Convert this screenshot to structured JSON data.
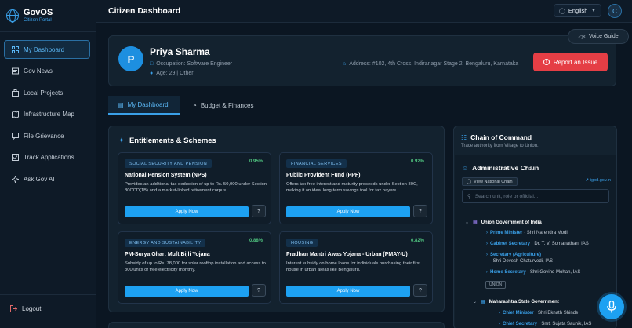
{
  "brand": {
    "name": "GovOS",
    "subtitle": "Citizen Portal"
  },
  "sidebar": {
    "items": [
      {
        "label": "My Dashboard",
        "icon": "dashboard-icon",
        "active": true
      },
      {
        "label": "Gov News",
        "icon": "news-icon"
      },
      {
        "label": "Local Projects",
        "icon": "briefcase-icon"
      },
      {
        "label": "Infrastructure Map",
        "icon": "map-icon"
      },
      {
        "label": "File Grievance",
        "icon": "grievance-icon"
      },
      {
        "label": "Track Applications",
        "icon": "checklist-icon"
      },
      {
        "label": "Ask Gov AI",
        "icon": "sparkle-icon"
      }
    ],
    "logout_label": "Logout"
  },
  "topbar": {
    "title": "Citizen Dashboard",
    "language": "English",
    "avatar_initial": "C"
  },
  "profile": {
    "initial": "P",
    "name": "Priya Sharma",
    "occupation": "Occupation: Software Engineer",
    "age": "Age: 29 | Other",
    "address": "Address: #102, 4th Cross, Indiranagar Stage 2, Bengaluru, Karnataka",
    "report_label": "Report an Issue",
    "voice_label": "Voice Guide"
  },
  "tabs": [
    {
      "label": "My Dashboard",
      "active": true
    },
    {
      "label": "Budget & Finances"
    }
  ],
  "entitlements": {
    "title": "Entitlements & Schemes",
    "apply_label": "Apply Now",
    "schemes": [
      {
        "tag": "SOCIAL SECURITY AND PENSION",
        "rate": "0.95%",
        "title": "National Pension System (NPS)",
        "desc": "Provides an additional tax deduction of up to Rs. 50,000 under Section 80CCD(1B) and a market-linked retirement corpus."
      },
      {
        "tag": "FINANCIAL SERVICES",
        "rate": "0.92%",
        "title": "Public Provident Fund (PPF)",
        "desc": "Offers tax-free interest and maturity proceeds under Section 80C, making it an ideal long-term savings tool for tax payers."
      },
      {
        "tag": "ENERGY AND SUSTAINABILITY",
        "rate": "0.88%",
        "title": "PM-Surya Ghar: Muft Bijli Yojana",
        "desc": "Subsidy of up to Rs. 78,000 for solar rooftop installation and access to 300 units of free electricity monthly."
      },
      {
        "tag": "HOUSING",
        "rate": "0.82%",
        "title": "Pradhan Mantri Awas Yojana - Urban (PMAY-U)",
        "desc": "Interest subsidy on home loans for individuals purchasing their first house in urban areas like Bengaluru."
      }
    ]
  },
  "chain": {
    "title": "Chain of Command",
    "subtitle": "Trace authority from Village to Union.",
    "admin_title": "Administrative Chain",
    "view_label": "View National Chain",
    "link_label": "igod.gov.in",
    "search_placeholder": "Search unit, role or official...",
    "union": {
      "name": "Union Government of India",
      "badge": "UNION",
      "officials": [
        {
          "role": "Prime Minister",
          "name": "Shri Narendra Modi"
        },
        {
          "role": "Cabinet Secretary",
          "name": "Dr. T. V. Somanathan, IAS"
        },
        {
          "role": "Secretary (Agriculture)",
          "name": "Shri Devesh Chaturvedi, IAS"
        },
        {
          "role": "Home Secretary",
          "name": "Shri Govind Mohan, IAS"
        }
      ]
    },
    "state": {
      "name": "Maharashtra State Government",
      "officials": [
        {
          "role": "Chief Minister",
          "name": "Shri Eknath Shinde"
        },
        {
          "role": "Chief Secretary",
          "name": "Smt. Sujata Saunik, IAS"
        }
      ]
    }
  },
  "colors": {
    "accent": "#1da1f2",
    "danger": "#e53e45",
    "success": "#4fc37f",
    "background": "#0b1622"
  }
}
